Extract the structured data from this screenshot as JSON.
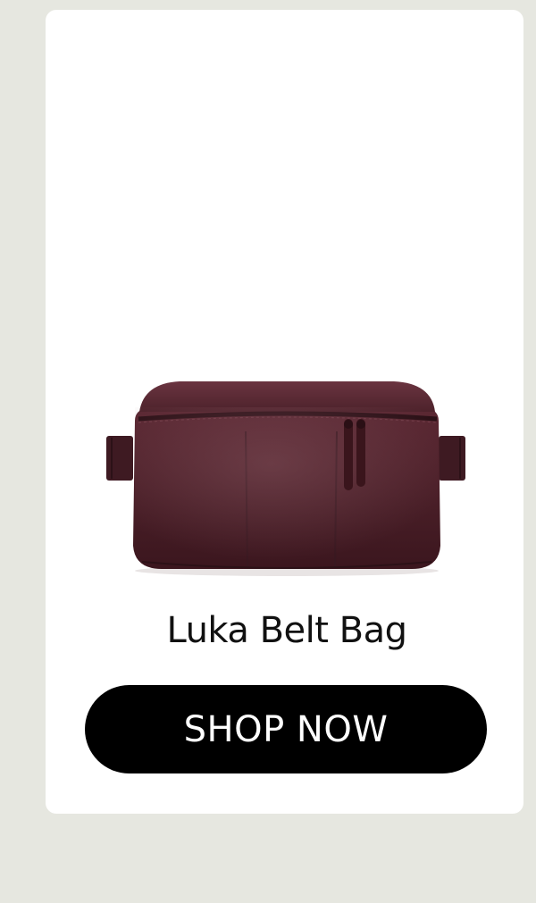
{
  "product": {
    "name": "Luka Belt Bag",
    "image_alt": "Luka Belt Bag in burgundy leather",
    "color": "#4a1f28"
  },
  "cta": {
    "label": "SHOP NOW"
  },
  "theme": {
    "page_background": "#e6e7e0",
    "card_background": "#ffffff",
    "button_background": "#000000",
    "button_text": "#ffffff"
  }
}
